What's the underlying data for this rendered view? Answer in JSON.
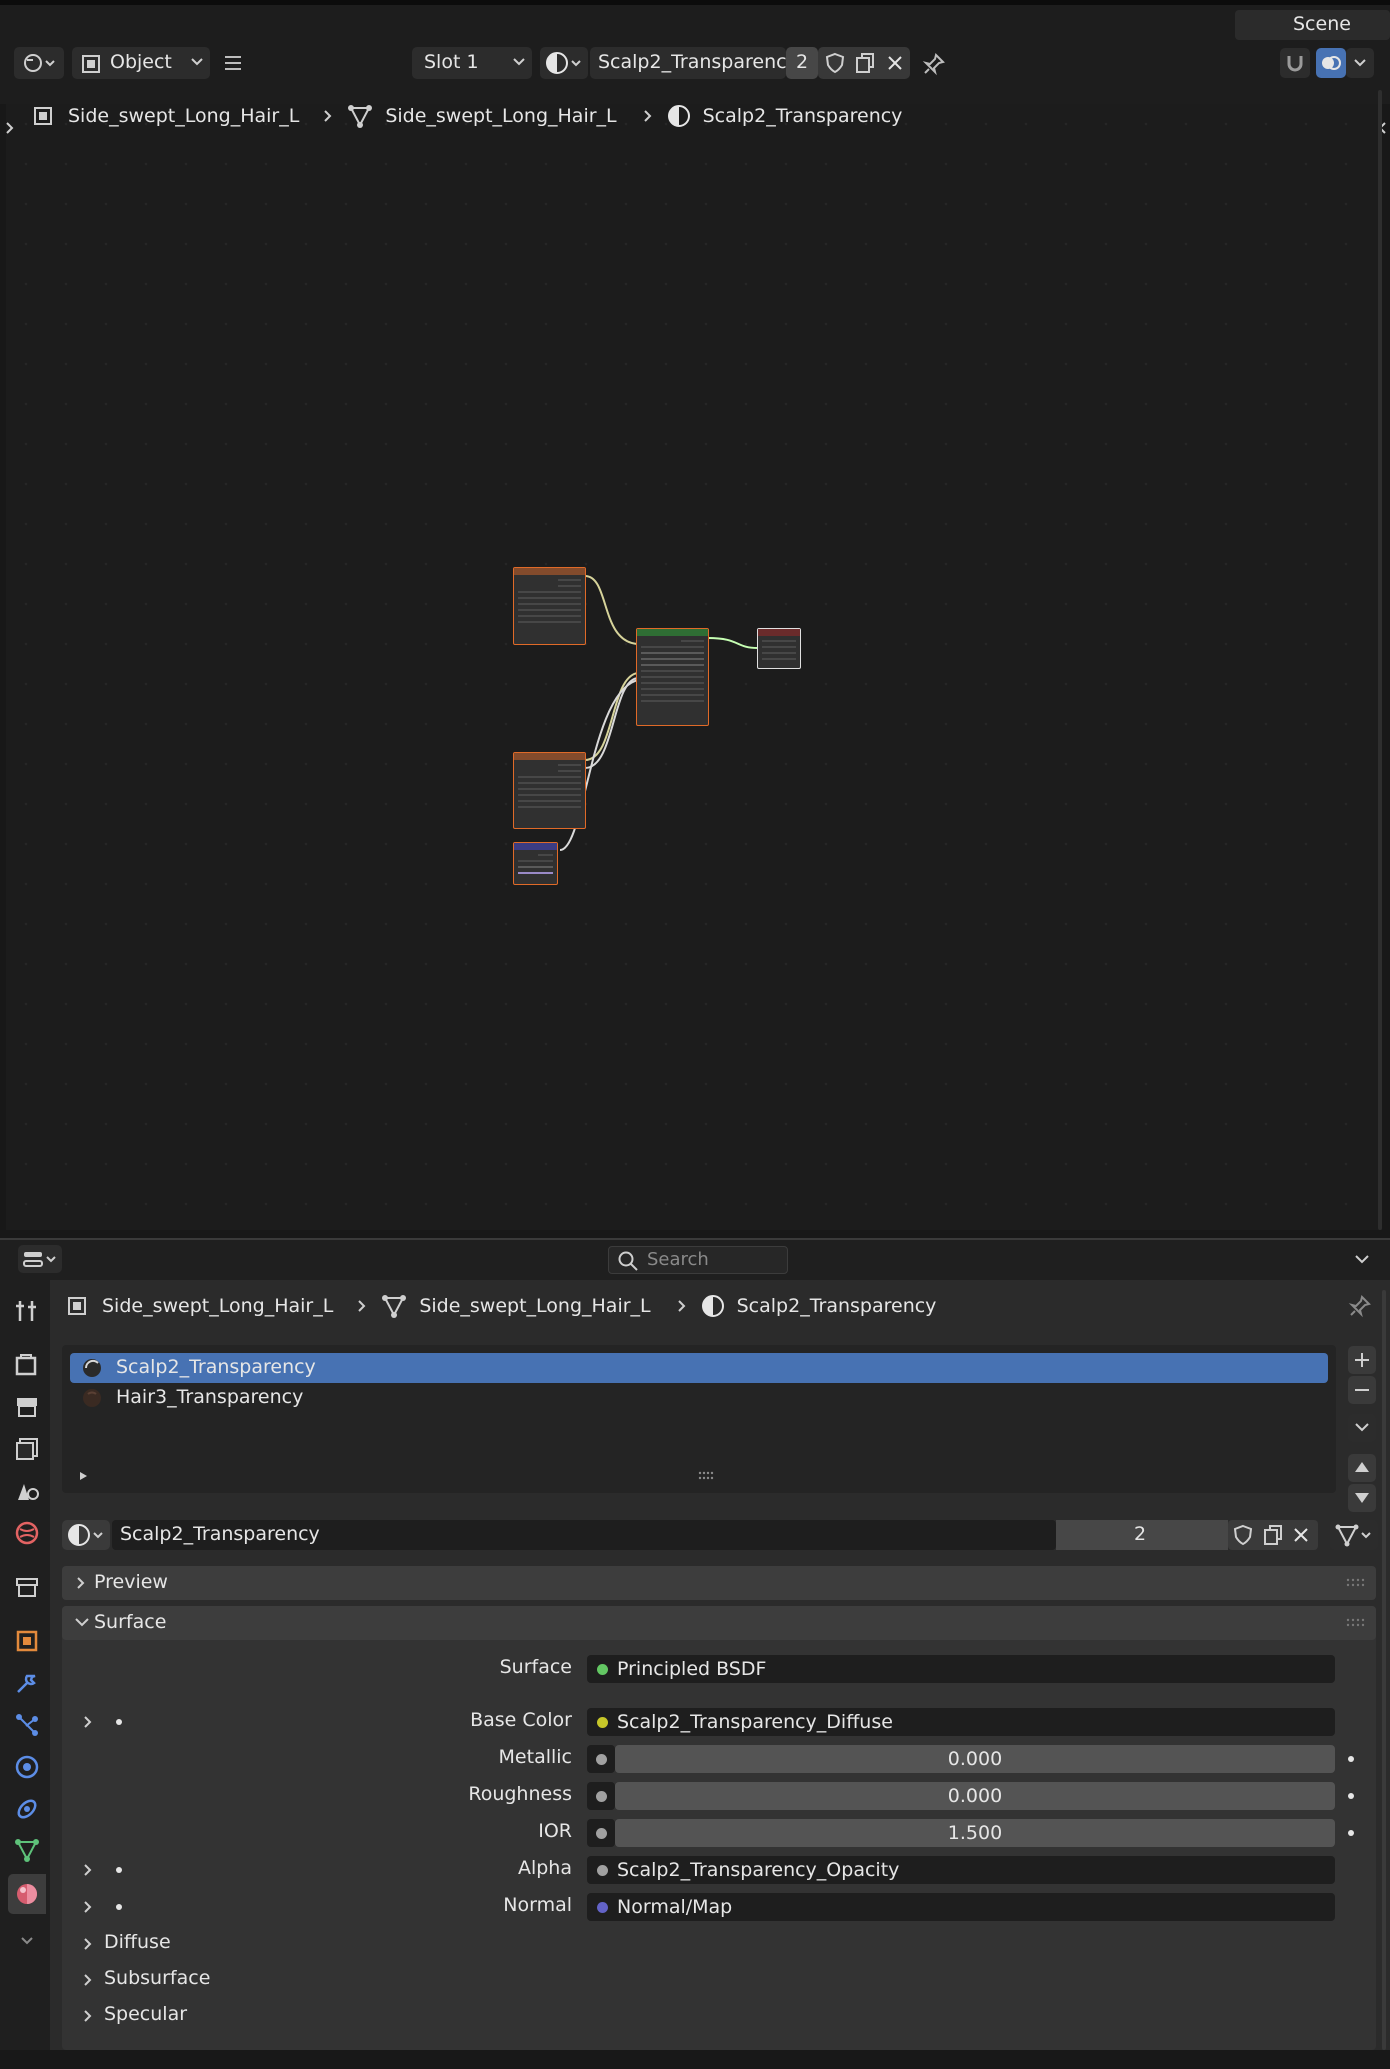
{
  "topbar": {
    "scene": "Scene"
  },
  "node_header": {
    "mode": "Object",
    "slot": "Slot 1",
    "material": "Scalp2_Transparency",
    "users": "2"
  },
  "breadcrumb": {
    "object": "Side_swept_Long_Hair_L",
    "mesh": "Side_swept_Long_Hair_L",
    "material": "Scalp2_Transparency"
  },
  "properties": {
    "search_placeholder": "Search",
    "breadcrumb": {
      "object": "Side_swept_Long_Hair_L",
      "mesh": "Side_swept_Long_Hair_L",
      "material": "Scalp2_Transparency"
    },
    "slots": [
      {
        "name": "Scalp2_Transparency"
      },
      {
        "name": "Hair3_Transparency"
      }
    ],
    "material_name": "Scalp2_Transparency",
    "material_users": "2",
    "panels": {
      "preview": "Preview",
      "surface": "Surface",
      "diffuse": "Diffuse",
      "subsurface": "Subsurface",
      "specular": "Specular"
    },
    "surface": {
      "surface_label": "Surface",
      "surface_value": "Principled BSDF",
      "base_color_label": "Base Color",
      "base_color_value": "Scalp2_Transparency_Diffuse",
      "metallic_label": "Metallic",
      "metallic_value": "0.000",
      "roughness_label": "Roughness",
      "roughness_value": "0.000",
      "ior_label": "IOR",
      "ior_value": "1.500",
      "alpha_label": "Alpha",
      "alpha_value": "Scalp2_Transparency_Opacity",
      "normal_label": "Normal",
      "normal_value": "Normal/Map"
    }
  },
  "colors": {
    "selected": "#4772b3",
    "node_outline": "#e06a28",
    "socket_green": "#63c763",
    "socket_yellow": "#c7c729",
    "socket_grey": "#a1a1a1",
    "socket_purple": "#6363c7"
  }
}
